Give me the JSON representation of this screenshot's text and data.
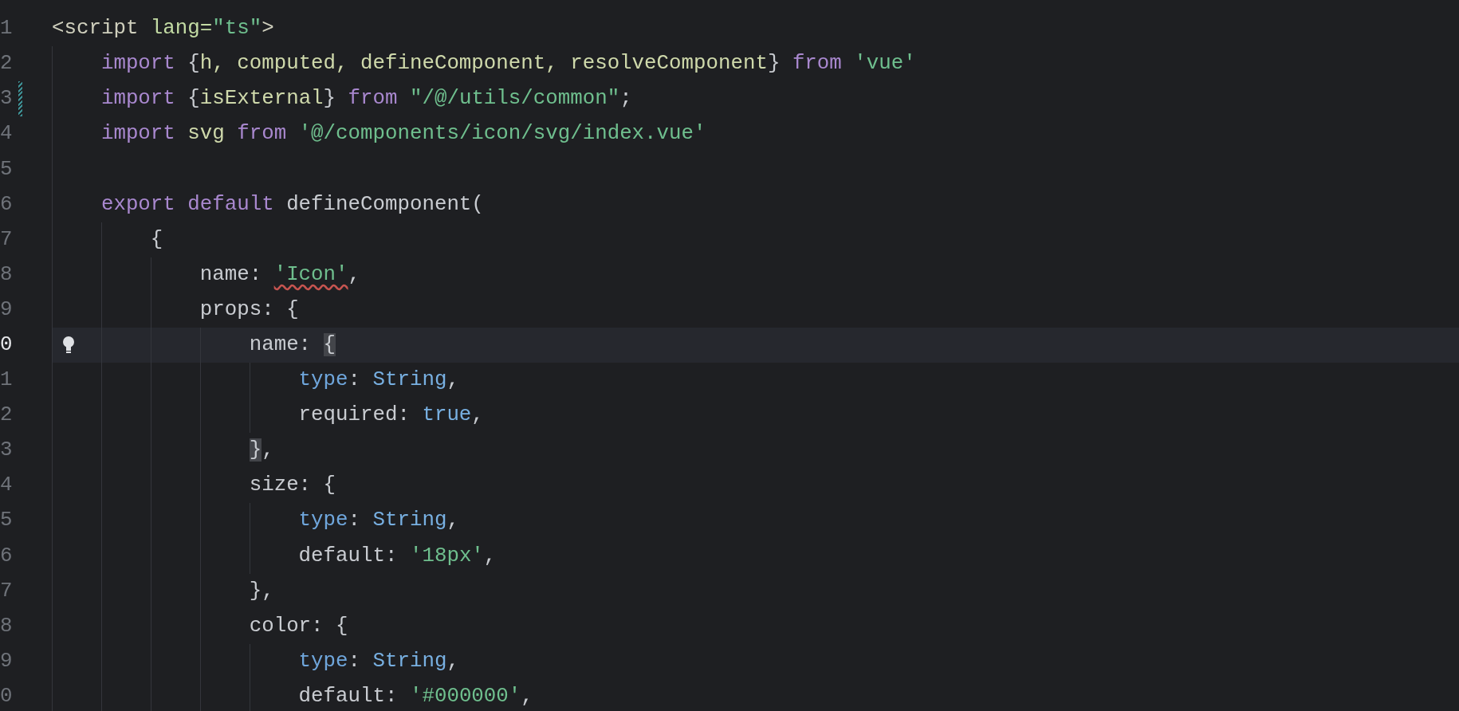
{
  "editor": {
    "lines": [
      {
        "number": "1",
        "current": false,
        "changed": false,
        "tokens": [
          {
            "kind": "tag",
            "text": "<script"
          },
          {
            "kind": "attr",
            "text": " lang="
          },
          {
            "kind": "string",
            "text": "\"ts\""
          },
          {
            "kind": "tag",
            "text": ">"
          }
        ]
      },
      {
        "number": "2",
        "current": false,
        "changed": false,
        "tokens": [
          {
            "kind": "keyword",
            "text": "    import"
          },
          {
            "kind": "plain",
            "text": " {"
          },
          {
            "kind": "ident",
            "text": "h, computed, defineComponent, resolveComponent"
          },
          {
            "kind": "plain",
            "text": "} "
          },
          {
            "kind": "keyword",
            "text": "from"
          },
          {
            "kind": "string",
            "text": " 'vue'"
          }
        ]
      },
      {
        "number": "3",
        "current": false,
        "changed": true,
        "tokens": [
          {
            "kind": "keyword",
            "text": "    import"
          },
          {
            "kind": "plain",
            "text": " {"
          },
          {
            "kind": "ident",
            "text": "isExternal"
          },
          {
            "kind": "plain",
            "text": "} "
          },
          {
            "kind": "keyword",
            "text": "from"
          },
          {
            "kind": "string",
            "text": " \"/@/utils/common\""
          },
          {
            "kind": "plain",
            "text": ";"
          }
        ]
      },
      {
        "number": "4",
        "current": false,
        "changed": false,
        "tokens": [
          {
            "kind": "keyword",
            "text": "    import"
          },
          {
            "kind": "ident",
            "text": " svg "
          },
          {
            "kind": "keyword",
            "text": "from"
          },
          {
            "kind": "string",
            "text": " '@/components/icon/svg/index.vue'"
          }
        ]
      },
      {
        "number": "5",
        "current": false,
        "changed": false
      },
      {
        "number": "6",
        "current": false,
        "changed": false,
        "tokens": [
          {
            "kind": "keyword",
            "text": "    export default"
          },
          {
            "kind": "plain",
            "text": " defineComponent("
          }
        ]
      },
      {
        "number": "7",
        "current": false,
        "changed": false,
        "tokens": [
          {
            "kind": "plain",
            "text": "        {"
          }
        ]
      },
      {
        "number": "8",
        "current": false,
        "changed": false,
        "tokens": [
          {
            "kind": "plain",
            "text": "            name: "
          },
          {
            "kind": "string",
            "text": "'Icon'",
            "error": true
          },
          {
            "kind": "plain",
            "text": ","
          }
        ]
      },
      {
        "number": "9",
        "current": false,
        "changed": false,
        "tokens": [
          {
            "kind": "plain",
            "text": "            props: {"
          }
        ]
      },
      {
        "number": "0",
        "current": true,
        "changed": false,
        "tokens": [
          {
            "kind": "plain",
            "text": "                name: "
          },
          {
            "kind": "plain",
            "text": "{",
            "matched": true
          }
        ]
      },
      {
        "number": "1",
        "current": false,
        "changed": false,
        "tokens": [
          {
            "kind": "prop",
            "text": "                    type"
          },
          {
            "kind": "plain",
            "text": ": "
          },
          {
            "kind": "value",
            "text": "String"
          },
          {
            "kind": "plain",
            "text": ","
          }
        ]
      },
      {
        "number": "2",
        "current": false,
        "changed": false,
        "tokens": [
          {
            "kind": "plain",
            "text": "                    required: "
          },
          {
            "kind": "value",
            "text": "true"
          },
          {
            "kind": "plain",
            "text": ","
          }
        ]
      },
      {
        "number": "3",
        "current": false,
        "changed": false,
        "tokens": [
          {
            "kind": "plain",
            "text": "                }",
            "matched": true
          },
          {
            "kind": "plain",
            "text": ","
          }
        ]
      },
      {
        "number": "4",
        "current": false,
        "changed": false,
        "tokens": [
          {
            "kind": "plain",
            "text": "                size: {"
          }
        ]
      },
      {
        "number": "5",
        "current": false,
        "changed": false,
        "tokens": [
          {
            "kind": "prop",
            "text": "                    type"
          },
          {
            "kind": "plain",
            "text": ": "
          },
          {
            "kind": "value",
            "text": "String"
          },
          {
            "kind": "plain",
            "text": ","
          }
        ]
      },
      {
        "number": "6",
        "current": false,
        "changed": false,
        "tokens": [
          {
            "kind": "plain",
            "text": "                    default: "
          },
          {
            "kind": "string",
            "text": "'18px'"
          },
          {
            "kind": "plain",
            "text": ","
          }
        ]
      },
      {
        "number": "7",
        "current": false,
        "changed": false,
        "tokens": [
          {
            "kind": "plain",
            "text": "                },"
          }
        ]
      },
      {
        "number": "8",
        "current": false,
        "changed": false,
        "tokens": [
          {
            "kind": "plain",
            "text": "                color: {"
          }
        ]
      },
      {
        "number": "9",
        "current": false,
        "changed": false,
        "tokens": [
          {
            "kind": "prop",
            "text": "                    type"
          },
          {
            "kind": "plain",
            "text": ": "
          },
          {
            "kind": "value",
            "text": "String"
          },
          {
            "kind": "plain",
            "text": ","
          }
        ]
      },
      {
        "number": "0",
        "current": false,
        "changed": false,
        "tokens": [
          {
            "kind": "plain",
            "text": "                    default: "
          },
          {
            "kind": "string",
            "text": "'#000000'"
          },
          {
            "kind": "plain",
            "text": ","
          }
        ]
      }
    ]
  }
}
